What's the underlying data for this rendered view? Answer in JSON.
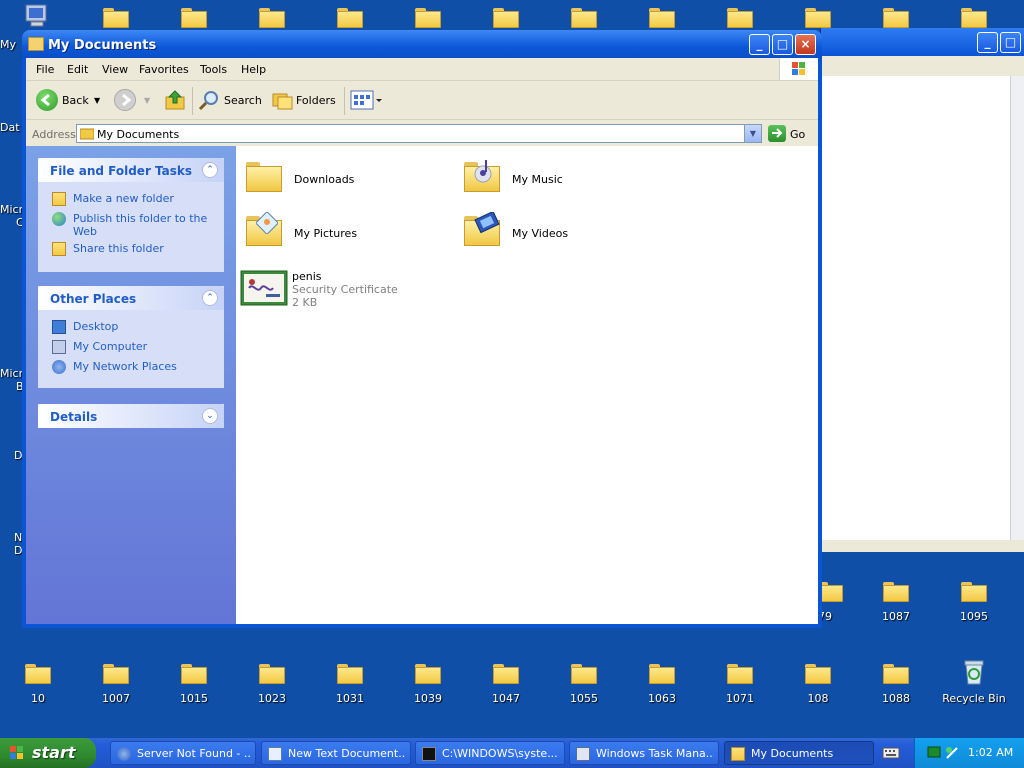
{
  "desktop": {
    "top_row_icons": 13,
    "edge_labels": [
      "My",
      "Dat",
      "Micr",
      "C",
      "Micr",
      "B",
      "D",
      "N",
      "D"
    ],
    "right_icons": [
      {
        "label": "79"
      },
      {
        "label": "1087"
      },
      {
        "label": "1095"
      }
    ],
    "bottom_icons": [
      {
        "label": "10"
      },
      {
        "label": "1007"
      },
      {
        "label": "1015"
      },
      {
        "label": "1023"
      },
      {
        "label": "1031"
      },
      {
        "label": "1039"
      },
      {
        "label": "1047"
      },
      {
        "label": "1055"
      },
      {
        "label": "1063"
      },
      {
        "label": "1071"
      },
      {
        "label": "108"
      },
      {
        "label": "1088"
      }
    ],
    "recycle_bin": "Recycle Bin"
  },
  "window": {
    "title": "My Documents",
    "icons": {
      "minimize": "minimize-icon",
      "maximize": "maximize-icon",
      "close": "close-icon"
    }
  },
  "menu": [
    "File",
    "Edit",
    "View",
    "Favorites",
    "Tools",
    "Help"
  ],
  "toolbar": {
    "back": "Back",
    "search": "Search",
    "folders": "Folders"
  },
  "address": {
    "label": "Address",
    "value": "My Documents",
    "go": "Go"
  },
  "tasks_panel": {
    "title": "File and Folder Tasks",
    "items": [
      "Make a new folder",
      "Publish this folder to the Web",
      "Share this folder"
    ]
  },
  "places_panel": {
    "title": "Other Places",
    "items": [
      "Desktop",
      "My Computer",
      "My Network Places"
    ]
  },
  "details_panel": {
    "title": "Details"
  },
  "files": [
    {
      "name": "Downloads",
      "type": "folder"
    },
    {
      "name": "My Music",
      "type": "folder"
    },
    {
      "name": "My Pictures",
      "type": "folder"
    },
    {
      "name": "My Videos",
      "type": "folder"
    },
    {
      "name": "penis",
      "kind": "Security Certificate",
      "size": "2 KB",
      "type": "certificate"
    }
  ],
  "taskbar": {
    "start": "start",
    "tasks": [
      {
        "label": "Server Not Found - ..."
      },
      {
        "label": "New Text Document..."
      },
      {
        "label": "C:\\WINDOWS\\syste..."
      },
      {
        "label": "Windows Task Mana..."
      },
      {
        "label": "My Documents"
      }
    ],
    "clock": "1:02 AM"
  }
}
